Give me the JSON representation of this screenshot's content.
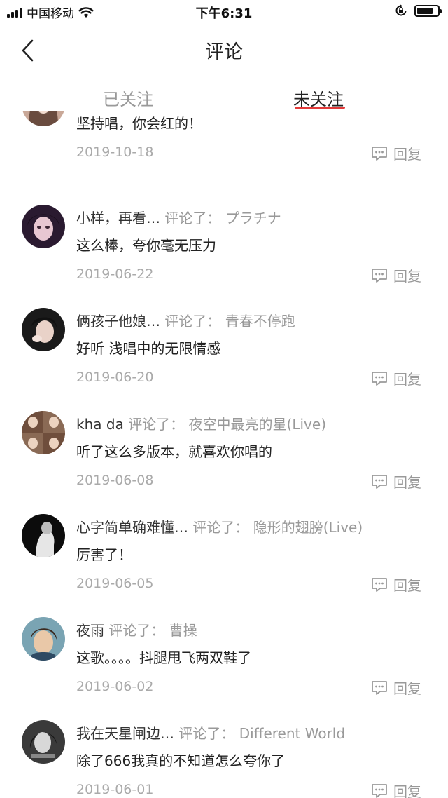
{
  "status_bar": {
    "carrier": "中国移动",
    "time": "下午6:31"
  },
  "nav": {
    "title": "评论"
  },
  "tabs": [
    {
      "label": "已关注",
      "active": false
    },
    {
      "label": "未关注",
      "active": true
    }
  ],
  "reply_label": "回复",
  "comments": [
    {
      "user": "",
      "sep": "",
      "song": "",
      "text": "坚持唱，你会红的！",
      "date": "2019-10-18"
    },
    {
      "user": "小样，再看…",
      "sep": "评论了：",
      "song": "プラチナ",
      "text": "这么棒，夸你毫无压力",
      "date": "2019-06-22"
    },
    {
      "user": "俩孩子他娘…",
      "sep": "评论了：",
      "song": "青春不停跑",
      "text": "好听 浅唱中的无限情感",
      "date": "2019-06-20"
    },
    {
      "user": "kha da",
      "sep": "评论了：",
      "song": "夜空中最亮的星(Live)",
      "text": "听了这么多版本，就喜欢你唱的",
      "date": "2019-06-08"
    },
    {
      "user": "心字简单确难懂…",
      "sep": "评论了：",
      "song": "隐形的翅膀(Live)",
      "text": "厉害了！",
      "date": "2019-06-05"
    },
    {
      "user": "夜雨",
      "sep": "评论了：",
      "song": "曹操",
      "text": "这歌。。。。抖腿甩飞两双鞋了",
      "date": "2019-06-02"
    },
    {
      "user": "我在天星闸边…",
      "sep": "评论了：",
      "song": "Different World",
      "text": "除了666我真的不知道怎么夸你了",
      "date": "2019-06-01"
    }
  ],
  "colors": {
    "accent": "#e33a3a",
    "muted_text": "#999999",
    "date_text": "#aaaaaa"
  }
}
